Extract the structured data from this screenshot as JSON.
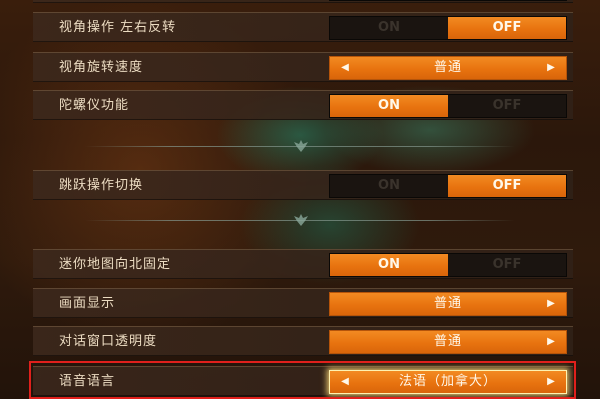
{
  "settings": {
    "rows": [
      {
        "label": "视角操作 左右反转",
        "type": "toggle",
        "on": "ON",
        "off": "OFF",
        "active": "off"
      },
      {
        "label": "视角旋转速度",
        "type": "selector",
        "value": "普通",
        "has_left": true
      },
      {
        "label": "陀螺仪功能",
        "type": "toggle",
        "on": "ON",
        "off": "OFF",
        "active": "on"
      },
      {
        "label": "跳跃操作切换",
        "type": "toggle",
        "on": "ON",
        "off": "OFF",
        "active": "off"
      },
      {
        "label": "迷你地图向北固定",
        "type": "toggle",
        "on": "ON",
        "off": "OFF",
        "active": "on"
      },
      {
        "label": "画面显示",
        "type": "selector",
        "value": "普通",
        "has_left": false
      },
      {
        "label": "对话窗口透明度",
        "type": "selector",
        "value": "普通",
        "has_left": false
      },
      {
        "label": "语音语言",
        "type": "selector",
        "value": "法语（加拿大）",
        "has_left": true,
        "highlighted": true
      }
    ]
  },
  "icons": {
    "left_arrow": "◀",
    "right_arrow": "▶",
    "divider_ornament": "winged-crest-icon"
  },
  "colors": {
    "accent_orange": "#e8730f",
    "highlight_red": "#e0201c"
  }
}
